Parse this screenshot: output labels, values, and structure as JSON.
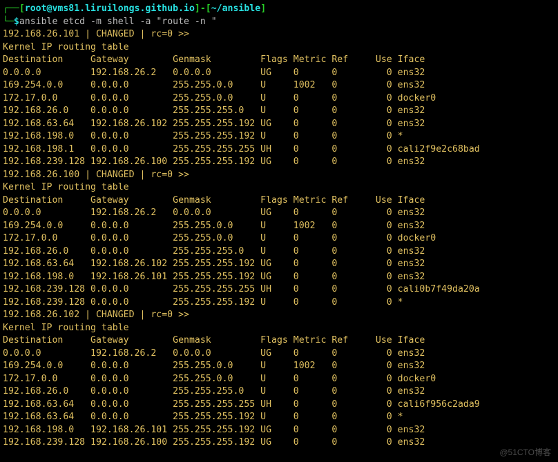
{
  "prompt": {
    "indent1": "┌──[",
    "user_host": "root@vms81.liruilongs.github.io",
    "mid": "]-[",
    "cwd": "~/ansible",
    "end": "]",
    "indent2": "└─",
    "dollar": "$",
    "command": "ansible etcd -m shell -a \"route -n \""
  },
  "blocks": [
    {
      "host_line": "192.168.26.101 | CHANGED | rc=0 >>",
      "title": "Kernel IP routing table",
      "header": [
        "Destination",
        "Gateway",
        "Genmask",
        "Flags",
        "Metric",
        "Ref",
        "Use",
        "Iface"
      ],
      "rows": [
        [
          "0.0.0.0",
          "192.168.26.2",
          "0.0.0.0",
          "UG",
          "0",
          "0",
          "0",
          "ens32"
        ],
        [
          "169.254.0.0",
          "0.0.0.0",
          "255.255.0.0",
          "U",
          "1002",
          "0",
          "0",
          "ens32"
        ],
        [
          "172.17.0.0",
          "0.0.0.0",
          "255.255.0.0",
          "U",
          "0",
          "0",
          "0",
          "docker0"
        ],
        [
          "192.168.26.0",
          "0.0.0.0",
          "255.255.255.0",
          "U",
          "0",
          "0",
          "0",
          "ens32"
        ],
        [
          "192.168.63.64",
          "192.168.26.102",
          "255.255.255.192",
          "UG",
          "0",
          "0",
          "0",
          "ens32"
        ],
        [
          "192.168.198.0",
          "0.0.0.0",
          "255.255.255.192",
          "U",
          "0",
          "0",
          "0",
          "*"
        ],
        [
          "192.168.198.1",
          "0.0.0.0",
          "255.255.255.255",
          "UH",
          "0",
          "0",
          "0",
          "cali2f9e2c68bad"
        ],
        [
          "192.168.239.128",
          "192.168.26.100",
          "255.255.255.192",
          "UG",
          "0",
          "0",
          "0",
          "ens32"
        ]
      ]
    },
    {
      "host_line": "192.168.26.100 | CHANGED | rc=0 >>",
      "title": "Kernel IP routing table",
      "header": [
        "Destination",
        "Gateway",
        "Genmask",
        "Flags",
        "Metric",
        "Ref",
        "Use",
        "Iface"
      ],
      "rows": [
        [
          "0.0.0.0",
          "192.168.26.2",
          "0.0.0.0",
          "UG",
          "0",
          "0",
          "0",
          "ens32"
        ],
        [
          "169.254.0.0",
          "0.0.0.0",
          "255.255.0.0",
          "U",
          "1002",
          "0",
          "0",
          "ens32"
        ],
        [
          "172.17.0.0",
          "0.0.0.0",
          "255.255.0.0",
          "U",
          "0",
          "0",
          "0",
          "docker0"
        ],
        [
          "192.168.26.0",
          "0.0.0.0",
          "255.255.255.0",
          "U",
          "0",
          "0",
          "0",
          "ens32"
        ],
        [
          "192.168.63.64",
          "192.168.26.102",
          "255.255.255.192",
          "UG",
          "0",
          "0",
          "0",
          "ens32"
        ],
        [
          "192.168.198.0",
          "192.168.26.101",
          "255.255.255.192",
          "UG",
          "0",
          "0",
          "0",
          "ens32"
        ],
        [
          "192.168.239.128",
          "0.0.0.0",
          "255.255.255.255",
          "UH",
          "0",
          "0",
          "0",
          "cali0b7f49da20a"
        ],
        [
          "192.168.239.128",
          "0.0.0.0",
          "255.255.255.192",
          "U",
          "0",
          "0",
          "0",
          "*"
        ]
      ]
    },
    {
      "host_line": "192.168.26.102 | CHANGED | rc=0 >>",
      "title": "Kernel IP routing table",
      "header": [
        "Destination",
        "Gateway",
        "Genmask",
        "Flags",
        "Metric",
        "Ref",
        "Use",
        "Iface"
      ],
      "rows": [
        [
          "0.0.0.0",
          "192.168.26.2",
          "0.0.0.0",
          "UG",
          "0",
          "0",
          "0",
          "ens32"
        ],
        [
          "169.254.0.0",
          "0.0.0.0",
          "255.255.0.0",
          "U",
          "1002",
          "0",
          "0",
          "ens32"
        ],
        [
          "172.17.0.0",
          "0.0.0.0",
          "255.255.0.0",
          "U",
          "0",
          "0",
          "0",
          "docker0"
        ],
        [
          "192.168.26.0",
          "0.0.0.0",
          "255.255.255.0",
          "U",
          "0",
          "0",
          "0",
          "ens32"
        ],
        [
          "192.168.63.64",
          "0.0.0.0",
          "255.255.255.255",
          "UH",
          "0",
          "0",
          "0",
          "cali6f956c2ada9"
        ],
        [
          "192.168.63.64",
          "0.0.0.0",
          "255.255.255.192",
          "U",
          "0",
          "0",
          "0",
          "*"
        ],
        [
          "192.168.198.0",
          "192.168.26.101",
          "255.255.255.192",
          "UG",
          "0",
          "0",
          "0",
          "ens32"
        ],
        [
          "192.168.239.128",
          "192.168.26.100",
          "255.255.255.192",
          "UG",
          "0",
          "0",
          "0",
          "ens32"
        ]
      ]
    }
  ],
  "watermark": "@51CTO博客"
}
